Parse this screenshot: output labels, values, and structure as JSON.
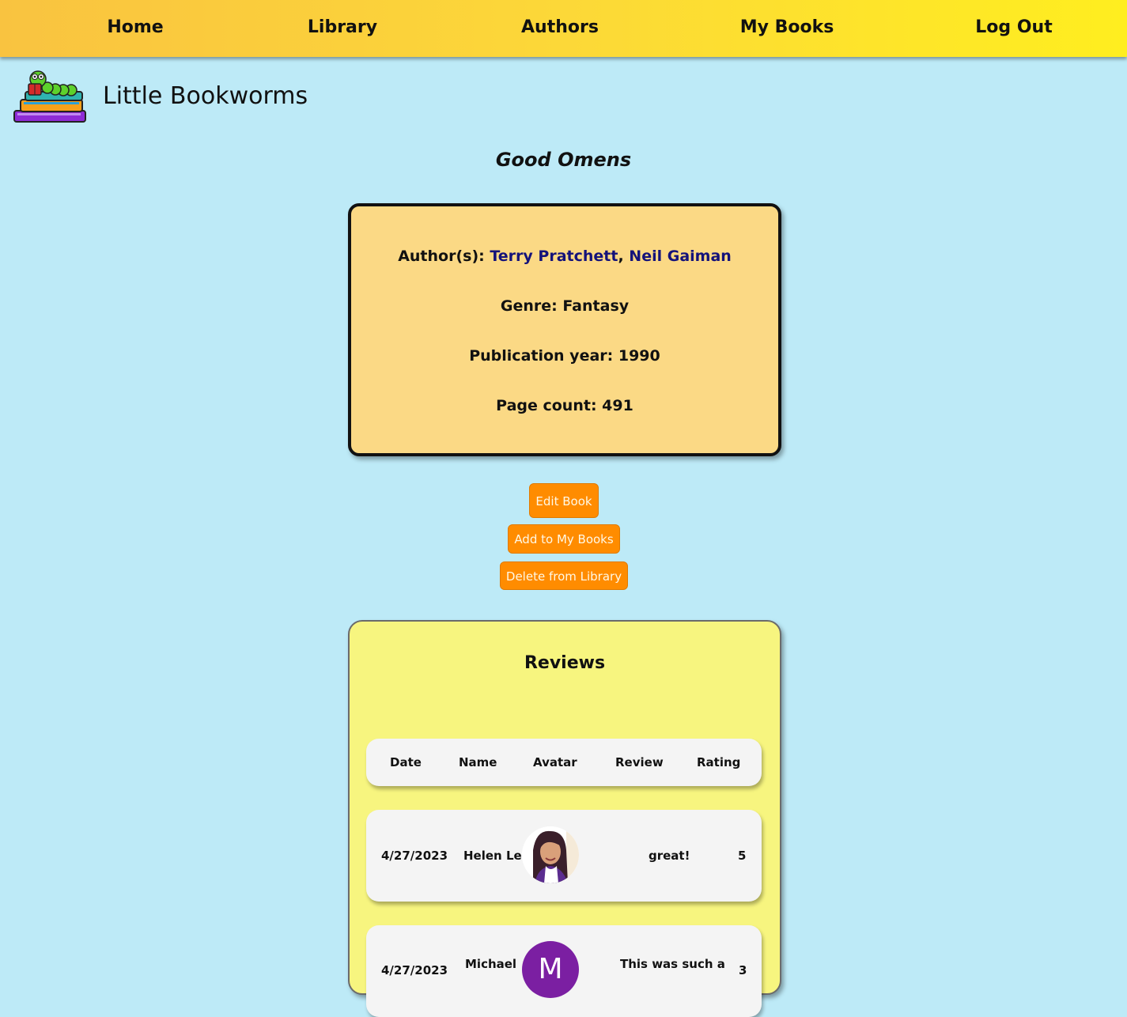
{
  "nav": {
    "home": "Home",
    "library": "Library",
    "authors": "Authors",
    "my_books": "My Books",
    "log_out": "Log Out"
  },
  "site": {
    "title": "Little Bookworms"
  },
  "book": {
    "title": "Good Omens",
    "authors_label": "Author(s): ",
    "authors": [
      "Terry Pratchett",
      "Neil Gaiman"
    ],
    "author_separator": ", ",
    "genre": "Genre: Fantasy",
    "publication_year": "Publication year: 1990",
    "page_count": "Page count: 491"
  },
  "actions": {
    "edit": "Edit Book",
    "add": "Add to My Books",
    "delete": "Delete from Library"
  },
  "reviews": {
    "heading": "Reviews",
    "columns": [
      "Date",
      "Name",
      "Avatar",
      "Review",
      "Rating"
    ],
    "rows": [
      {
        "date": "4/27/2023",
        "name": "Helen Le",
        "avatar": "photo",
        "review": "great!",
        "rating": "5"
      },
      {
        "date": "4/27/2023",
        "name": "Michael",
        "avatar": "M",
        "review": "This was such a",
        "rating": "3"
      }
    ]
  },
  "colors": {
    "page_bg": "#bdeaf7",
    "nav_gradient_start": "#f9c340",
    "nav_gradient_end": "#ffee1f",
    "info_card_bg": "#fbd985",
    "button_bg": "#ff8c00",
    "reviews_bg": "#f7f57f",
    "author_link": "#14127a",
    "avatar_m_bg": "#7b1fa2"
  },
  "icons": {
    "logo": "bookworm-on-books-logo"
  }
}
